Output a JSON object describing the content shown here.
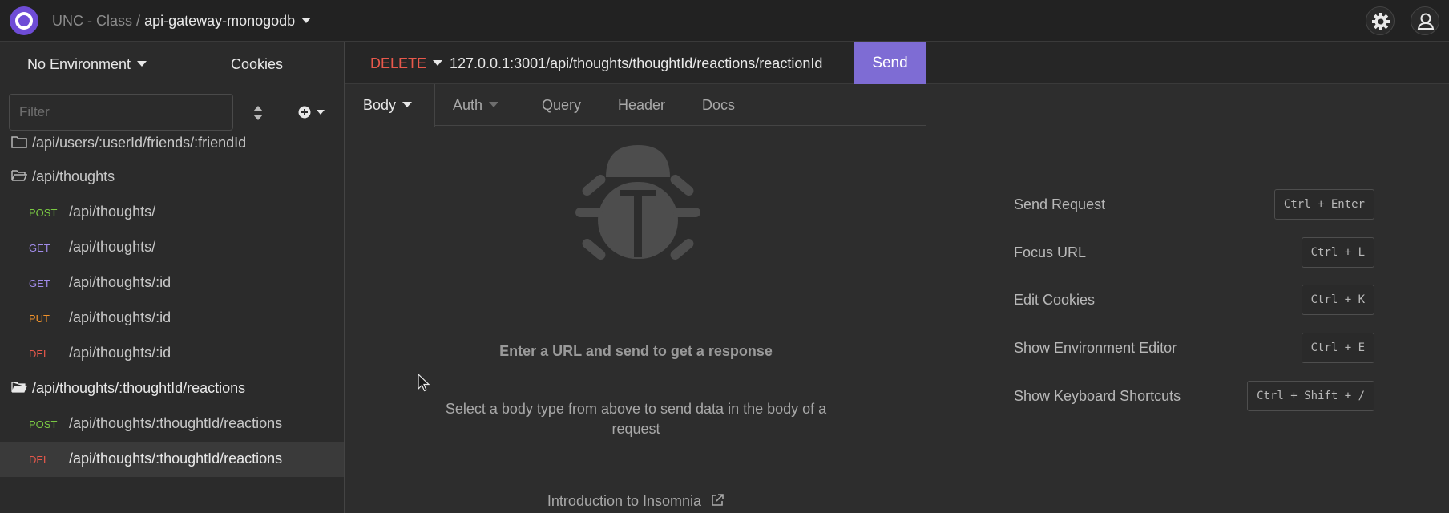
{
  "header": {
    "workspace": "UNC - Class",
    "separator": "/",
    "project": "api-gateway-monogodb"
  },
  "sidebar": {
    "environment": "No Environment",
    "cookies": "Cookies",
    "filter_placeholder": "Filter",
    "items": [
      {
        "type": "folder",
        "label": "/api/users/:userId/friends/:friendId",
        "open": false
      },
      {
        "type": "folder",
        "label": "/api/thoughts",
        "open": true
      },
      {
        "type": "request",
        "method": "POST",
        "label": "/api/thoughts/"
      },
      {
        "type": "request",
        "method": "GET",
        "label": "/api/thoughts/"
      },
      {
        "type": "request",
        "method": "GET",
        "label": "/api/thoughts/:id"
      },
      {
        "type": "request",
        "method": "PUT",
        "label": "/api/thoughts/:id"
      },
      {
        "type": "request",
        "method": "DEL",
        "label": "/api/thoughts/:id"
      },
      {
        "type": "folder",
        "label": "/api/thoughts/:thoughtId/reactions",
        "open": true
      },
      {
        "type": "request",
        "method": "POST",
        "label": "/api/thoughts/:thoughtId/reactions"
      },
      {
        "type": "request",
        "method": "DEL",
        "label": "/api/thoughts/:thoughtId/reactions",
        "active": true
      }
    ]
  },
  "request": {
    "method": "DELETE",
    "url": "127.0.0.1:3001/api/thoughts/thoughtId/reactions/reactionId",
    "send_label": "Send",
    "tabs": [
      "Body",
      "Auth",
      "Query",
      "Header",
      "Docs"
    ],
    "active_tab": "Body",
    "empty_title": "Enter a URL and send to get a response",
    "empty_desc": "Select a body type from above to send data in the body of a request",
    "intro_link": "Introduction to Insomnia"
  },
  "shortcuts": [
    {
      "label": "Send Request",
      "keys": "Ctrl + Enter"
    },
    {
      "label": "Focus URL",
      "keys": "Ctrl + L"
    },
    {
      "label": "Edit Cookies",
      "keys": "Ctrl + K"
    },
    {
      "label": "Show Environment Editor",
      "keys": "Ctrl + E"
    },
    {
      "label": "Show Keyboard Shortcuts",
      "keys": "Ctrl + Shift + /"
    }
  ],
  "colors": {
    "accent": "#7e6cd4",
    "method_post": "#7ac943",
    "method_get": "#a08be8",
    "method_put": "#f0922b",
    "method_del": "#e8584b"
  },
  "icons": [
    "app-logo-icon",
    "settings-gear-icon",
    "account-user-icon",
    "sort-icon",
    "add-plus-icon",
    "folder-open-icon",
    "folder-closed-icon",
    "bug-icon",
    "external-link-icon",
    "mouse-cursor-icon"
  ]
}
